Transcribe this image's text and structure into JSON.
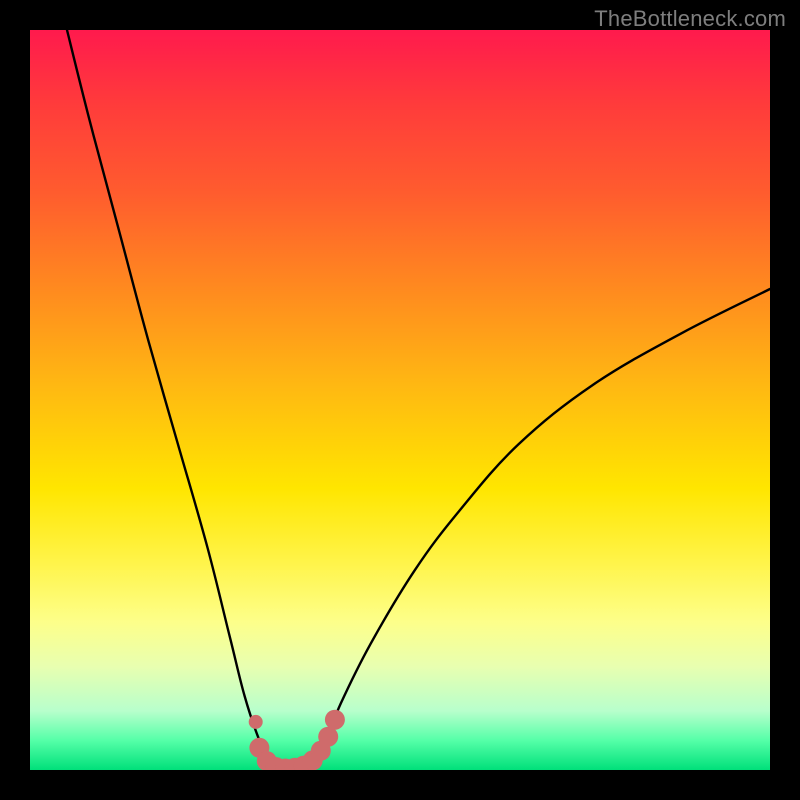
{
  "watermark": "TheBottleneck.com",
  "chart_data": {
    "type": "line",
    "title": "",
    "xlabel": "",
    "ylabel": "",
    "xlim": [
      0,
      100
    ],
    "ylim": [
      0,
      100
    ],
    "series": [
      {
        "name": "bottleneck-curve",
        "x": [
          5,
          8,
          12,
          16,
          20,
          24,
          27,
          29,
          31,
          32.5,
          34,
          36,
          38,
          40,
          42,
          46,
          52,
          58,
          66,
          76,
          88,
          100
        ],
        "y": [
          100,
          88,
          73,
          58,
          44,
          30,
          18,
          10,
          4,
          1,
          0,
          0,
          1,
          4,
          9,
          17,
          27,
          35,
          44,
          52,
          59,
          65
        ]
      }
    ],
    "highlight": {
      "name": "optimal-range-markers",
      "color": "#cf6b6b",
      "points": [
        {
          "x": 30.5,
          "y": 6.5
        },
        {
          "x": 31.0,
          "y": 3.0
        },
        {
          "x": 32.0,
          "y": 1.2
        },
        {
          "x": 33.2,
          "y": 0.4
        },
        {
          "x": 34.5,
          "y": 0.2
        },
        {
          "x": 35.8,
          "y": 0.3
        },
        {
          "x": 37.0,
          "y": 0.6
        },
        {
          "x": 38.2,
          "y": 1.3
        },
        {
          "x": 39.3,
          "y": 2.6
        },
        {
          "x": 40.3,
          "y": 4.5
        },
        {
          "x": 41.2,
          "y": 6.8
        }
      ]
    },
    "background_gradient": {
      "top": "#ff1a4d",
      "mid": "#ffe600",
      "bottom": "#00e07a"
    }
  }
}
